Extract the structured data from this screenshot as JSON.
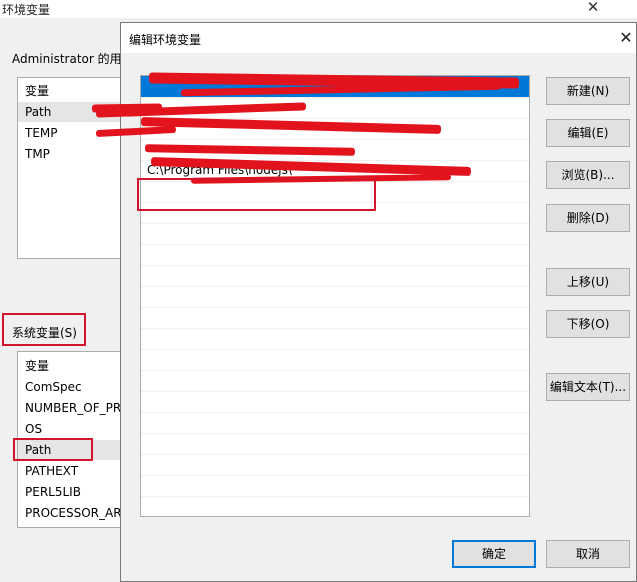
{
  "background_window": {
    "title": "环境变量",
    "close_glyph": "✕",
    "user_group_label": "Administrator 的用",
    "user_vars": {
      "header": "变量",
      "items": [
        "Path",
        "TEMP",
        "TMP"
      ]
    },
    "system_group_label": "系统变量(S)",
    "system_vars": {
      "header": "变量",
      "items": [
        "ComSpec",
        "NUMBER_OF_PR",
        "OS",
        "Path",
        "PATHEXT",
        "PERL5LIB",
        "PROCESSOR_AR"
      ]
    }
  },
  "dialog": {
    "title": "编辑环境变量",
    "close_glyph": "✕",
    "entries": [
      "",
      "",
      "",
      "",
      "C:\\Program Files\\nodejs\\"
    ],
    "buttons": {
      "new": "新建(N)",
      "edit": "编辑(E)",
      "browse": "浏览(B)...",
      "delete": "删除(D)",
      "move_up": "上移(U)",
      "move_down": "下移(O)",
      "edit_text": "编辑文本(T)...",
      "ok": "确定",
      "cancel": "取消"
    }
  },
  "colors": {
    "annotation_red": "#d3142b",
    "selection_blue": "#0078d7"
  }
}
